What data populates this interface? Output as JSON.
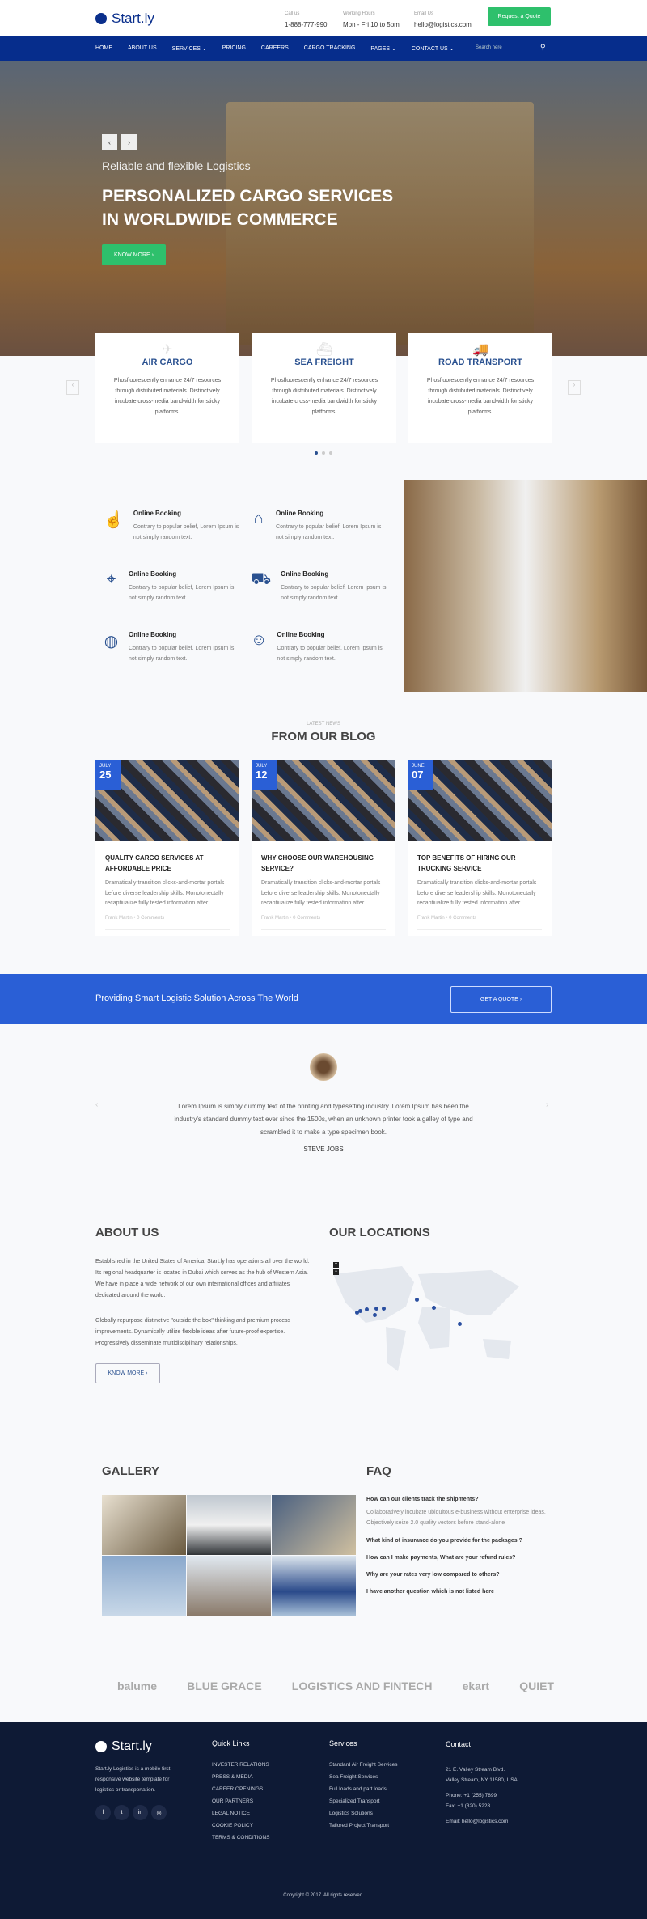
{
  "header": {
    "brand": "Start.ly",
    "call_label": "Call us",
    "call_value": "1-888-777-990",
    "hours_label": "Working Hours",
    "hours_value": "Mon - Fri 10 to 5pm",
    "email_label": "Email Us",
    "email_value": "hello@logistics.com",
    "quote_button": "Request a Quote"
  },
  "nav": {
    "items": [
      "HOME",
      "ABOUT US",
      "SERVICES ⌄",
      "PRICING",
      "CAREERS",
      "CARGO TRACKING",
      "PAGES ⌄",
      "CONTACT US ⌄"
    ],
    "search_placeholder": "Search here"
  },
  "hero": {
    "subtitle": "Reliable and flexible Logistics",
    "title_line1": "PERSONALIZED CARGO SERVICES",
    "title_line2": "IN WORLDWIDE COMMERCE",
    "button": "KNOW MORE  ›",
    "prev": "‹",
    "next": "›"
  },
  "services": [
    {
      "icon": "plane-icon",
      "title": "AIR CARGO",
      "text": "Phosfluorescently enhance 24/7 resources through distributed materials. Distinctively incubate cross-media bandwidth for sticky platforms."
    },
    {
      "icon": "ship-icon",
      "title": "SEA FREIGHT",
      "text": "Phosfluorescently enhance 24/7 resources through distributed materials. Distinctively incubate cross-media bandwidth for sticky platforms."
    },
    {
      "icon": "truck-icon",
      "title": "ROAD TRANSPORT",
      "text": "Phosfluorescently enhance 24/7 resources through distributed materials. Distinctively incubate cross-media bandwidth for sticky platforms."
    }
  ],
  "features": [
    {
      "icon": "hand-click-icon",
      "title": "Online Booking",
      "text": "Contrary to popular belief, Lorem Ipsum is not simply random text."
    },
    {
      "icon": "warehouse-icon",
      "title": "Online Booking",
      "text": "Contrary to popular belief, Lorem Ipsum is not simply random text."
    },
    {
      "icon": "route-pin-icon",
      "title": "Online Booking",
      "text": "Contrary to popular belief, Lorem Ipsum is not simply random text."
    },
    {
      "icon": "delivery-truck-icon",
      "title": "Online Booking",
      "text": "Contrary to popular belief, Lorem Ipsum is not simply random text."
    },
    {
      "icon": "globe-plane-icon",
      "title": "Online Booking",
      "text": "Contrary to popular belief, Lorem Ipsum is not simply random text."
    },
    {
      "icon": "support-agent-icon",
      "title": "Online Booking",
      "text": "Contrary to popular belief, Lorem Ipsum is not simply random text."
    }
  ],
  "blog": {
    "kicker": "LATEST NEWS",
    "title": "FROM OUR BLOG",
    "posts": [
      {
        "month": "JULY",
        "day": "25",
        "title": "QUALITY CARGO SERVICES AT AFFORDABLE PRICE",
        "text": "Dramatically transition clicks-and-mortar portals before diverse leadership skills. Monotonectally recaptiualize fully tested information after.",
        "meta": "Frank Martin  •  0 Comments"
      },
      {
        "month": "JULY",
        "day": "12",
        "title": "WHY CHOOSE OUR WAREHOUSING SERVICE?",
        "text": "Dramatically transition clicks-and-mortar portals before diverse leadership skills. Monotonectally recaptiualize fully tested information after.",
        "meta": "Frank Martin  •  0 Comments"
      },
      {
        "month": "JUNE",
        "day": "07",
        "title": "TOP BENEFITS OF HIRING OUR TRUCKING SERVICE",
        "text": "Dramatically transition clicks-and-mortar portals before diverse leadership skills. Monotonectally recaptiualize fully tested information after.",
        "meta": "Frank Martin  •  0 Comments"
      }
    ]
  },
  "cta": {
    "text": "Providing Smart Logistic Solution Across The World",
    "button": "GET A QUOTE   ›"
  },
  "testimonial": {
    "quote": "Lorem Ipsum is simply dummy text of the printing and typesetting industry. Lorem Ipsum has been the industry's standard dummy text ever since the 1500s, when an unknown printer took a galley of type and scrambled it to make a type specimen book.",
    "author": "STEVE JOBS",
    "prev": "‹",
    "next": "›"
  },
  "about": {
    "title": "ABOUT US",
    "p1": "Established in the United States of America, Start.ly has operations all over the world. Its regional headquarter is located in Dubai which serves as the hub of Western Asia. We have in place a wide network of our own international offices and affiliates dedicated around the world.",
    "p2": "Globally repurpose distinctive \"outside the box\" thinking and premium process improvements. Dynamically utilize flexible ideas after future-proof expertise. Progressively disseminate multidisciplinary relationships.",
    "button": "KNOW MORE  ›"
  },
  "locations": {
    "title": "OUR LOCATIONS",
    "zoom_in": "+",
    "zoom_out": "−"
  },
  "gallery": {
    "title": "GALLERY"
  },
  "faq": {
    "title": "FAQ",
    "items": [
      {
        "q": "How can our clients track the shipments?",
        "a": "Collaboratively incubate ubiquitous e-business without enterprise ideas. Objectively seize 2.0 quality vectors before stand-alone"
      },
      {
        "q": "What kind of insurance do you provide for the packages ?"
      },
      {
        "q": "How can I make payments, What are your refund rules?"
      },
      {
        "q": "Why are your rates very low compared to others?"
      },
      {
        "q": "I have another question which is not listed here"
      }
    ]
  },
  "partners": [
    "balume",
    "BLUE GRACE",
    "LOGISTICS AND FINTECH",
    "ekart",
    "QUIET"
  ],
  "footer": {
    "brand": "Start.ly",
    "about": "Start.ly Logistics is a mobile first responsive website template for logistics or transportation.",
    "social": [
      "f",
      "t",
      "in",
      "◎"
    ],
    "quick_title": "Quick Links",
    "quick": [
      "INVESTER RELATIONS",
      "PRESS & MEDIA",
      "CAREER OPENINGS",
      "OUR PARTNERS",
      "LEGAL NOTICE",
      "COOKIE POLICY",
      "TERMS & CONDITIONS"
    ],
    "services_title": "Services",
    "services": [
      "Standard Air Freight Services",
      "Sea Freight Services",
      "Full loads and part loads",
      "Specialized Transport",
      "Logistics Solutions",
      "Tailored Project Transport"
    ],
    "contact_title": "Contact",
    "address1": "21 E. Valley Stream Blvd.",
    "address2": "Valley Stream, NY 11580, USA",
    "phone": "Phone:  +1 (255) 7899",
    "fax": "Fax:  +1 (320) 5228",
    "email": "Email:  hello@logistics.com",
    "copyright": "Copyright © 2017. All rights reserved."
  },
  "colors": {
    "navy": "#062d8c",
    "accent_blue": "#2a5fd6",
    "green": "#2ec06c",
    "footer": "#0e1a35"
  }
}
